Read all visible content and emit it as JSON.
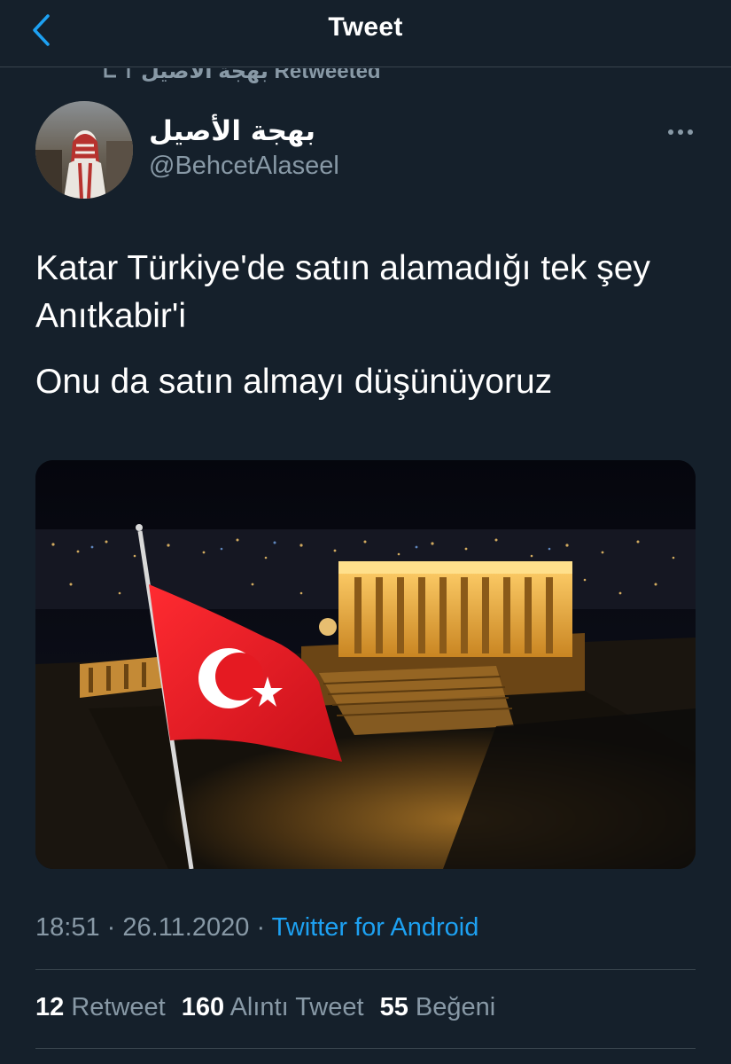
{
  "header": {
    "title": "Tweet",
    "back_icon": "chevron-left-icon"
  },
  "retweet_banner": {
    "icon": "retweet-icon",
    "text": "بهجة الأصيل Retweeted"
  },
  "author": {
    "display_name": "بهجة الأصيل",
    "handle": "@BehcetAlaseel"
  },
  "tweet": {
    "paragraphs": [
      "Katar Türkiye'de satın alamadığı tek şey Anıtkabir'i",
      "Onu da satın almayı düşünüyoruz"
    ]
  },
  "meta": {
    "time": "18:51",
    "separator": "·",
    "date": "26.11.2020",
    "source": "Twitter for Android"
  },
  "stats": {
    "retweets_count": "12",
    "retweets_label": "Retweet",
    "quotes_count": "160",
    "quotes_label": "Alıntı Tweet",
    "likes_count": "55",
    "likes_label": "Beğeni"
  },
  "colors": {
    "background": "#15202b",
    "accent": "#1da1f2",
    "secondary_text": "#8899a6",
    "border": "#38444d"
  }
}
